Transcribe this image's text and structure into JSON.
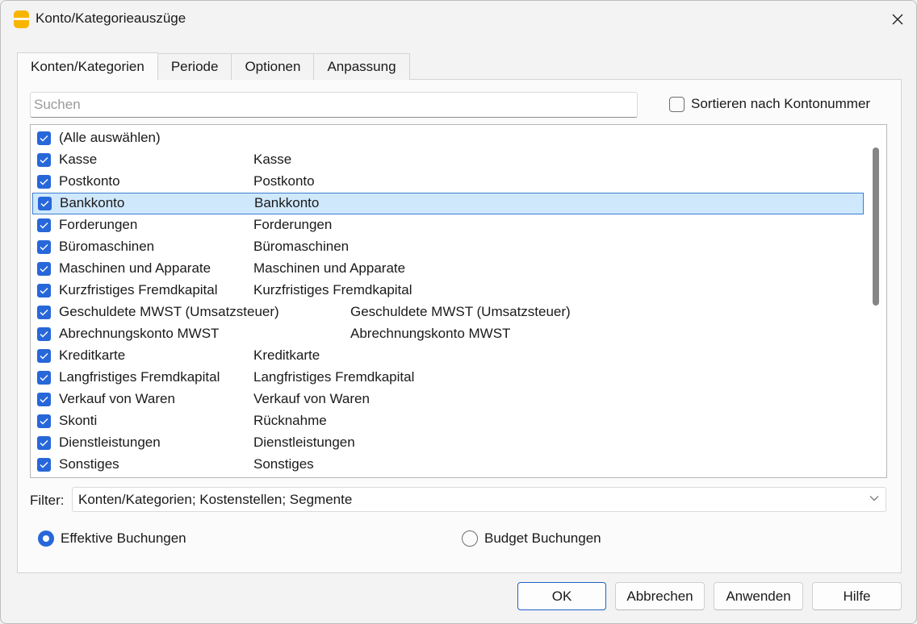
{
  "window": {
    "title": "Konto/Kategorieauszüge"
  },
  "tabs": [
    {
      "label": "Konten/Kategorien",
      "active": true
    },
    {
      "label": "Periode",
      "active": false
    },
    {
      "label": "Optionen",
      "active": false
    },
    {
      "label": "Anpassung",
      "active": false
    }
  ],
  "search": {
    "placeholder": "Suchen",
    "value": ""
  },
  "sort_option": {
    "label": "Sortieren nach Kontonummer",
    "checked": false
  },
  "accounts": {
    "select_all": "(Alle auswählen)",
    "rows": [
      {
        "name": "Kasse",
        "description": "Kasse",
        "checked": true
      },
      {
        "name": "Postkonto",
        "description": "Postkonto",
        "checked": true
      },
      {
        "name": "Bankkonto",
        "description": "Bankkonto",
        "checked": true,
        "selected": true
      },
      {
        "name": "Forderungen",
        "description": "Forderungen",
        "checked": true
      },
      {
        "name": "Büromaschinen",
        "description": "Büromaschinen",
        "checked": true
      },
      {
        "name": "Maschinen und Apparate",
        "description": "Maschinen und Apparate",
        "checked": true
      },
      {
        "name": "Kurzfristiges Fremdkapital",
        "description": "Kurzfristiges Fremdkapital",
        "checked": true
      },
      {
        "name": "Geschuldete MWST (Umsatzsteuer)",
        "description": "Geschuldete MWST (Umsatzsteuer)",
        "checked": true
      },
      {
        "name": "Abrechnungskonto MWST",
        "description": "Abrechnungskonto MWST",
        "checked": true
      },
      {
        "name": "Kreditkarte",
        "description": "Kreditkarte",
        "checked": true
      },
      {
        "name": "Langfristiges Fremdkapital",
        "description": "Langfristiges Fremdkapital",
        "checked": true
      },
      {
        "name": "Verkauf von Waren",
        "description": "Verkauf von Waren",
        "checked": true
      },
      {
        "name": "Skonti",
        "description": "Rücknahme",
        "checked": true
      },
      {
        "name": "Dienstleistungen",
        "description": "Dienstleistungen",
        "checked": true
      },
      {
        "name": "Sonstiges",
        "description": "Sonstiges",
        "checked": true
      }
    ]
  },
  "filter": {
    "label": "Filter:",
    "value": "Konten/Kategorien; Kostenstellen; Segmente"
  },
  "booking_type": {
    "effective": {
      "label": "Effektive Buchungen",
      "selected": true
    },
    "budget": {
      "label": "Budget Buchungen",
      "selected": false
    }
  },
  "buttons": {
    "ok": "OK",
    "cancel": "Abbrechen",
    "apply": "Anwenden",
    "help": "Hilfe"
  },
  "colors": {
    "accent": "#2767d9",
    "selection_bg": "#cfe8fc",
    "selection_border": "#3d7fcf",
    "app_icon": "#f7b500"
  }
}
